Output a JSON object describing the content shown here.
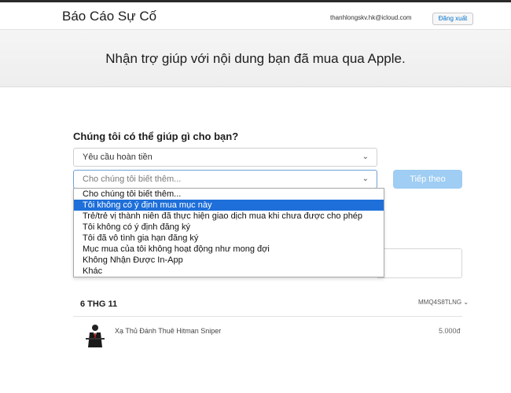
{
  "header": {
    "title": "Báo Cáo Sự Cố",
    "account_email": "thanhlongskv.hk@icloud.com",
    "signout_label": "Đăng xuất"
  },
  "hero": {
    "text": "Nhận trợ giúp với nội dung bạn đã mua qua Apple."
  },
  "form": {
    "question": "Chúng tôi có thể giúp gì cho bạn?",
    "reason_value": "Yêu cầu hoàn tiền",
    "detail_placeholder": "Cho chúng tôi biết thêm...",
    "next_label": "Tiếp theo",
    "dropdown_icon": "chevron-down-icon",
    "dropdown_options": [
      "Cho chúng tôi biết thêm...",
      "Tôi không có ý định mua mục này",
      "Trẻ/trẻ vị thành niên đã thực hiện giao dịch mua khi chưa được cho phép",
      "Tôi không có ý định đăng ký",
      "Tôi đã vô tình gia hạn đăng ký",
      "Mục mua của tôi không hoạt động như mong đợi",
      "Không Nhận Được In-App",
      "Khác"
    ],
    "highlighted_option_index": 1
  },
  "purchase": {
    "date": "6 THG 11",
    "order_id": "MMQ4S8TLNG ⌄",
    "item_name": "Xạ Thủ Đánh Thuê Hitman Sniper",
    "item_price": "5.000đ",
    "item_icon": "hitman-app-icon"
  },
  "colors": {
    "highlight": "#1e6fd9",
    "next_button": "#9fcdf3",
    "link": "#0070c9"
  }
}
